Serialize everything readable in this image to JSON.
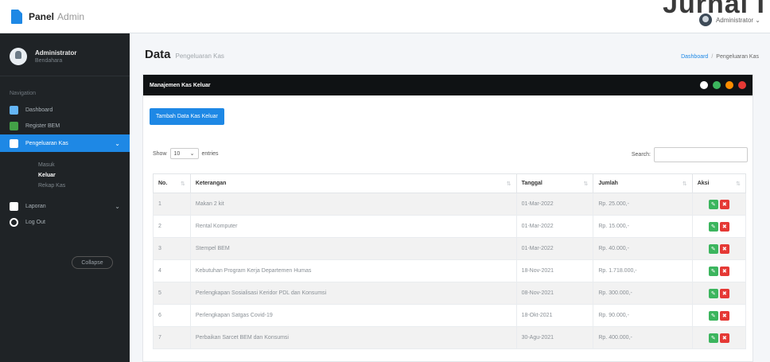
{
  "brand": {
    "name": "Panel",
    "sub": "Admin"
  },
  "watermark": "Jurnal I",
  "topbar": {
    "user": "Administrator"
  },
  "sidebar": {
    "user_name": "Administrator",
    "user_role": "Bendahara",
    "section": "Navigation",
    "items": [
      {
        "label": "Dashboard",
        "color": "#64b5f6"
      },
      {
        "label": "Register BEM",
        "color": "#43a047"
      },
      {
        "label": "Pengeluaran Kas",
        "color": "#ffffff"
      },
      {
        "label": "Laporan",
        "color": "#ffffff"
      },
      {
        "label": "Log Out",
        "color": "#ffffff"
      }
    ],
    "subitems": [
      "Masuk",
      "Keluar",
      "Rekap Kas"
    ],
    "collapse": "Collapse"
  },
  "page": {
    "title": "Data",
    "subtitle": "Pengeluaran Kas",
    "breadcrumb": [
      "Dashboard",
      "Pengeluaran Kas"
    ]
  },
  "card": {
    "title": "Manajemen Kas Keluar",
    "tool_colors": [
      "#ffffff",
      "#3cb55e",
      "#fb8c00",
      "#e53935"
    ]
  },
  "add_button": "Tambah Data Kas Keluar",
  "datatable": {
    "show_label": "Show",
    "show_value": "10",
    "entries_label": "entries",
    "search_label": "Search:",
    "search_value": ""
  },
  "table": {
    "headers": [
      "No.",
      "Keterangan",
      "Tanggal",
      "Jumlah",
      "Aksi"
    ],
    "rows": [
      {
        "no": "1",
        "ket": "Makan 2 kit",
        "tgl": "01-Mar-2022",
        "jml": "Rp. 25.000,-"
      },
      {
        "no": "2",
        "ket": "Rental Komputer",
        "tgl": "01-Mar-2022",
        "jml": "Rp. 15.000,-"
      },
      {
        "no": "3",
        "ket": "Stempel BEM",
        "tgl": "01-Mar-2022",
        "jml": "Rp. 40.000,-"
      },
      {
        "no": "4",
        "ket": "Kebutuhan Program Kerja Departemen Humas",
        "tgl": "18-Nov-2021",
        "jml": "Rp. 1.718.000,-"
      },
      {
        "no": "5",
        "ket": "Perlengkapan Sosialisasi Keridor PDL dan Konsumsi",
        "tgl": "08-Nov-2021",
        "jml": "Rp. 300.000,-"
      },
      {
        "no": "6",
        "ket": "Perlengkapan Satgas Covid-19",
        "tgl": "18-Okt-2021",
        "jml": "Rp. 90.000,-"
      },
      {
        "no": "7",
        "ket": "Perbaikan Sarcet BEM dan Konsumsi",
        "tgl": "30-Agu-2021",
        "jml": "Rp. 400.000,-"
      }
    ]
  }
}
